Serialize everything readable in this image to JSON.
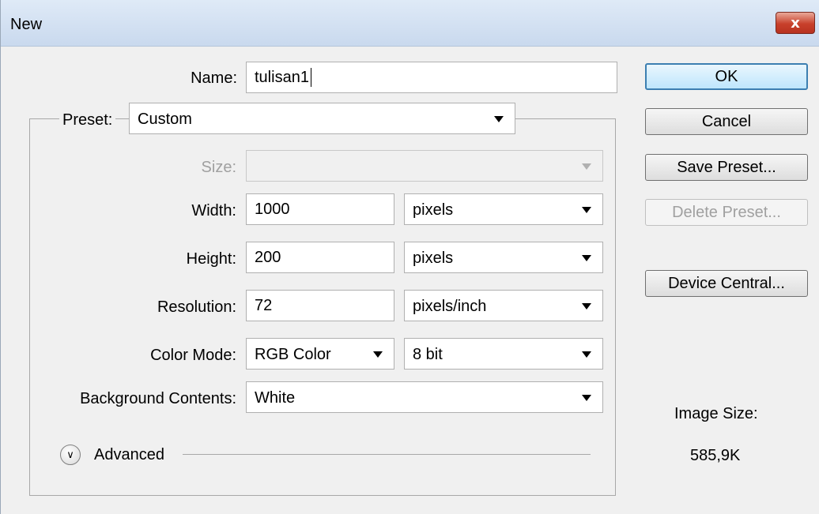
{
  "window": {
    "title": "New",
    "close_label": "x"
  },
  "form": {
    "name_label": "Name:",
    "name_value": "tulisan1",
    "preset_label": "Preset:",
    "preset_value": "Custom",
    "size_label": "Size:",
    "size_value": "",
    "width_label": "Width:",
    "width_value": "1000",
    "width_unit": "pixels",
    "height_label": "Height:",
    "height_value": "200",
    "height_unit": "pixels",
    "resolution_label": "Resolution:",
    "resolution_value": "72",
    "resolution_unit": "pixels/inch",
    "color_mode_label": "Color Mode:",
    "color_mode_value": "RGB Color",
    "bit_depth_value": "8 bit",
    "background_label": "Background Contents:",
    "background_value": "White",
    "advanced_label": "Advanced"
  },
  "buttons": {
    "ok": "OK",
    "cancel": "Cancel",
    "save_preset": "Save Preset...",
    "delete_preset": "Delete Preset...",
    "device_central": "Device Central..."
  },
  "image_size": {
    "label": "Image Size:",
    "value": "585,9K"
  },
  "icons": {
    "advanced_toggle": "double-chevron-down-icon",
    "close": "close-icon",
    "dropdown": "triangle-down-icon"
  }
}
